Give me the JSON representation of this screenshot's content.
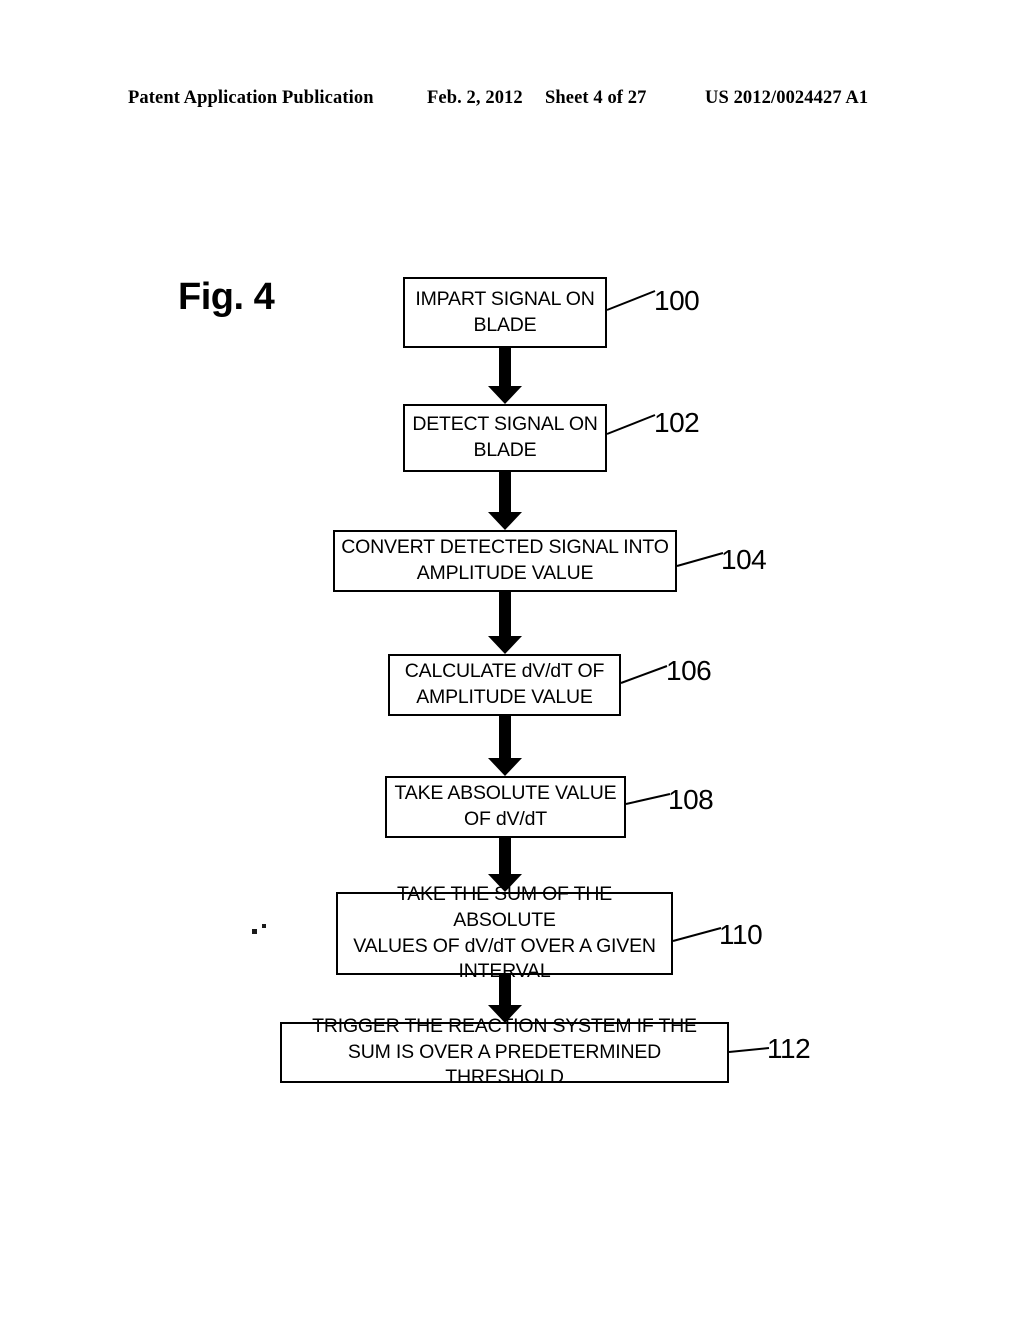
{
  "header": {
    "title": "Patent Application Publication",
    "date": "Feb. 2, 2012",
    "sheet": "Sheet 4 of 27",
    "publication_number": "US 2012/0024427 A1"
  },
  "figure": {
    "label": "Fig. 4",
    "type": "flowchart",
    "steps": [
      {
        "ref": "100",
        "text": "IMPART SIGNAL ON\nBLADE"
      },
      {
        "ref": "102",
        "text": "DETECT SIGNAL ON\nBLADE"
      },
      {
        "ref": "104",
        "text": "CONVERT DETECTED SIGNAL INTO\nAMPLITUDE VALUE"
      },
      {
        "ref": "106",
        "text": "CALCULATE dV/dT OF\nAMPLITUDE VALUE"
      },
      {
        "ref": "108",
        "text": "TAKE ABSOLUTE VALUE\nOF dV/dT"
      },
      {
        "ref": "110",
        "text": "TAKE THE SUM OF THE ABSOLUTE\nVALUES OF dV/dT OVER A GIVEN\nINTERVAL"
      },
      {
        "ref": "112",
        "text": "TRIGGER THE REACTION SYSTEM IF THE\nSUM IS OVER A PREDETERMINED THRESHOLD"
      }
    ],
    "connector": "downward-block-arrow",
    "connector_count": 6,
    "line_color": "#000000",
    "background_color": "#ffffff"
  }
}
